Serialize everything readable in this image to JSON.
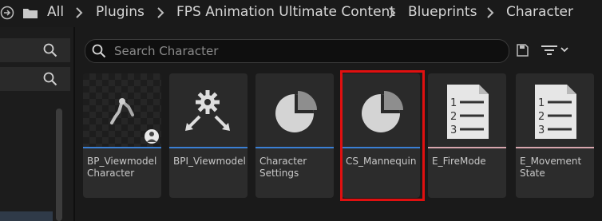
{
  "breadcrumb": {
    "items": [
      "All",
      "Plugins",
      "FPS Animation Ultimate Content",
      "Blueprints",
      "Character"
    ]
  },
  "search": {
    "placeholder": "Search Character"
  },
  "colors": {
    "selection": "#e01010",
    "blueprint_stripe": "#3a7fd4",
    "enum_stripe": "#d7a6ae"
  },
  "assets": [
    {
      "label": "BP_Viewmodel\nCharacter",
      "icon": "character-thumbnail",
      "stripe": "blue"
    },
    {
      "label": "BPI_Viewmodel",
      "icon": "interface-gear-icon",
      "stripe": "blue"
    },
    {
      "label": "Character\nSettings",
      "icon": "data-asset-pie-icon",
      "stripe": "blue"
    },
    {
      "label": "CS_Mannequin",
      "icon": "data-asset-pie-icon",
      "stripe": "blue",
      "selected": true
    },
    {
      "label": "E_FireMode",
      "icon": "enum-list-icon",
      "stripe": "pink"
    },
    {
      "label": "E_Movement\nState",
      "icon": "enum-list-icon",
      "stripe": "pink"
    }
  ]
}
